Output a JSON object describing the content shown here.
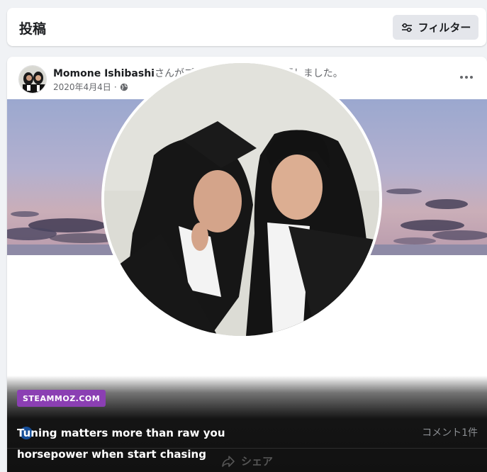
{
  "header": {
    "title": "投稿",
    "filter_label": "フィルター"
  },
  "post": {
    "author_name": "Momone Ishibashi",
    "action_text": "さんがプロフィール写真を変更しました。",
    "date": "2020年4月4日",
    "separator": "·",
    "comment_count": "コメント1件",
    "share_label": "シェア"
  },
  "overlay": {
    "badge": "STEAMMOZ.COM",
    "headline": "Tuning matters more than raw you horsepower when start chasing"
  },
  "icons": [
    "filter-sliders-icon",
    "globe-icon",
    "more-options-icon",
    "share-icon",
    "like-icon"
  ],
  "colors": {
    "badge_bg": "#8b3fb3",
    "header_bg": "#ffffff",
    "filter_bg": "#e4e6eb",
    "page_bg": "#f0f2f5"
  }
}
